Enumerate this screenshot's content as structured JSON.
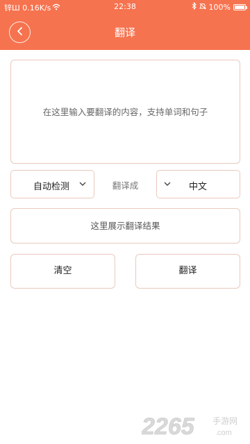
{
  "status_bar": {
    "left_text": "锌Ш 0.16K/s",
    "time": "22:38",
    "battery": "100%",
    "battery_level": 1.0
  },
  "header": {
    "title": "翻译"
  },
  "input": {
    "placeholder": "在这里输入要翻译的内容，支持单词和句子",
    "value": ""
  },
  "language": {
    "source": "自动检测",
    "connector": "翻译成",
    "target": "中文"
  },
  "result": {
    "placeholder": "这里展示翻译结果"
  },
  "buttons": {
    "clear": "清空",
    "translate": "翻译"
  },
  "watermark": {
    "number": "2265",
    "suffix": ".com",
    "text": "手游网"
  },
  "colors": {
    "accent": "#f6734f",
    "border": "#e9c9bd"
  }
}
